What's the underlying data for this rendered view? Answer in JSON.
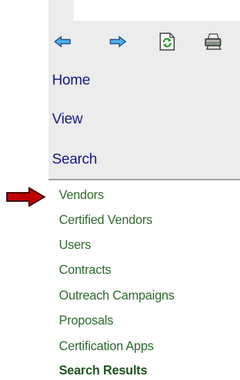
{
  "toolbar": {
    "back_icon": "back-arrow-icon",
    "forward_icon": "forward-arrow-icon",
    "refresh_icon": "refresh-icon",
    "print_icon": "printer-icon"
  },
  "nav": {
    "home": "Home",
    "view": "View",
    "search": "Search"
  },
  "search_menu": {
    "items": [
      "Vendors",
      "Certified Vendors",
      "Users",
      "Contracts",
      "Outreach Campaigns",
      "Proposals",
      "Certification Apps",
      "Search Results"
    ]
  },
  "colors": {
    "nav_link": "#1a1a80",
    "menu_item": "#2e6b2e",
    "pointer_arrow": "#b00000",
    "panel_bg": "#ececec"
  }
}
